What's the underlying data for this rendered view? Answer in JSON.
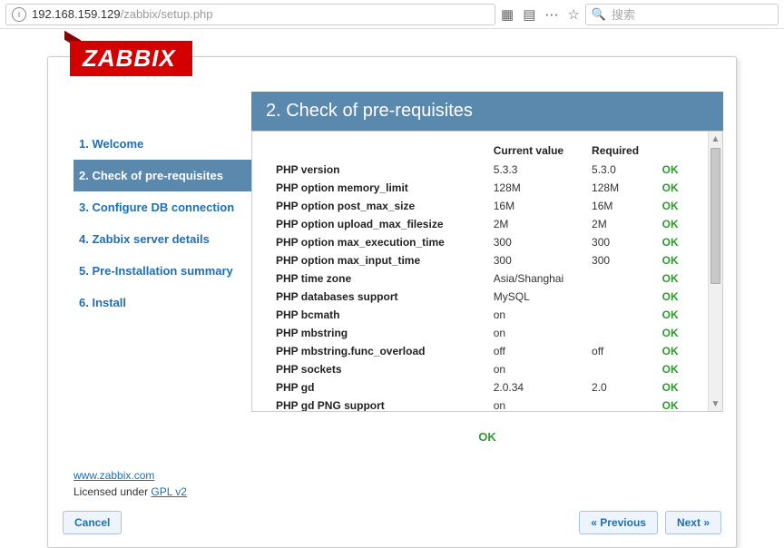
{
  "browser": {
    "url_host": "192.168.159.129",
    "url_path": "/zabbix/setup.php",
    "search_placeholder": "搜索"
  },
  "logo": {
    "text": "ZABBIX"
  },
  "sidebar": {
    "steps": [
      "1. Welcome",
      "2. Check of pre-requisites",
      "3. Configure DB connection",
      "4. Zabbix server details",
      "5. Pre-Installation summary",
      "6. Install"
    ],
    "active_index": 1
  },
  "content": {
    "heading": "2. Check of pre-requisites",
    "columns": {
      "name": "",
      "current": "Current value",
      "required": "Required",
      "status": ""
    },
    "rows": [
      {
        "name": "PHP version",
        "current": "5.3.3",
        "required": "5.3.0",
        "status": "OK"
      },
      {
        "name": "PHP option memory_limit",
        "current": "128M",
        "required": "128M",
        "status": "OK"
      },
      {
        "name": "PHP option post_max_size",
        "current": "16M",
        "required": "16M",
        "status": "OK"
      },
      {
        "name": "PHP option upload_max_filesize",
        "current": "2M",
        "required": "2M",
        "status": "OK"
      },
      {
        "name": "PHP option max_execution_time",
        "current": "300",
        "required": "300",
        "status": "OK"
      },
      {
        "name": "PHP option max_input_time",
        "current": "300",
        "required": "300",
        "status": "OK"
      },
      {
        "name": "PHP time zone",
        "current": "Asia/Shanghai",
        "required": "",
        "status": "OK"
      },
      {
        "name": "PHP databases support",
        "current": "MySQL",
        "required": "",
        "status": "OK"
      },
      {
        "name": "PHP bcmath",
        "current": "on",
        "required": "",
        "status": "OK"
      },
      {
        "name": "PHP mbstring",
        "current": "on",
        "required": "",
        "status": "OK"
      },
      {
        "name": "PHP mbstring.func_overload",
        "current": "off",
        "required": "off",
        "status": "OK"
      },
      {
        "name": "PHP sockets",
        "current": "on",
        "required": "",
        "status": "OK"
      },
      {
        "name": "PHP gd",
        "current": "2.0.34",
        "required": "2.0",
        "status": "OK"
      },
      {
        "name": "PHP gd PNG support",
        "current": "on",
        "required": "",
        "status": "OK"
      }
    ],
    "overall_status": "OK"
  },
  "footer": {
    "link_text": "www.zabbix.com",
    "license_prefix": "Licensed under ",
    "license_link": "GPL v2"
  },
  "buttons": {
    "cancel": "Cancel",
    "previous": "« Previous",
    "next": "Next »"
  }
}
